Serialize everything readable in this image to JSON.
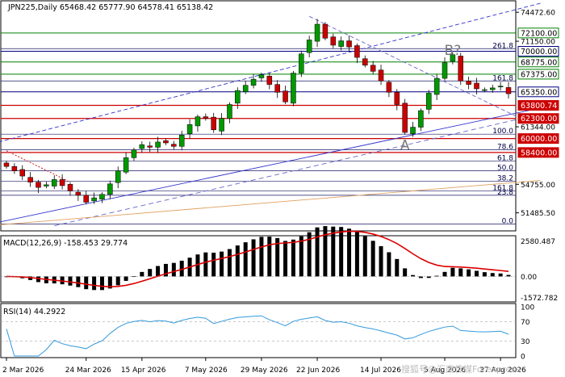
{
  "colors": {
    "background": "#ffffff",
    "panel_border": "#000000",
    "candle_up": "#009900",
    "candle_down": "#cc0000",
    "wick": "#000000",
    "green_level": "#008000",
    "red_level": "#cc0000",
    "navy_line": "#000080",
    "fib_line": "#1a1a66",
    "channel": "#3333cc",
    "trend": "#6666cc",
    "orange": "#e0a060",
    "macd_hist": "#000000",
    "macd_signal": "#dd0000",
    "rsi": "#3399dd",
    "level_box_green_bg": "#ffffff",
    "level_box_red_bg": "#cc0000"
  },
  "price_panel": {
    "header": "JPN225,Daily  65468.42 65777.90 64578.41 65138.42",
    "y_min": 49600,
    "y_max": 75600,
    "axis_ticks": [
      74472.6,
      71150.0,
      61344.0,
      54755.0,
      51485.5
    ],
    "level_boxes": [
      {
        "label": "72100.00",
        "value": 72100,
        "style": "green"
      },
      {
        "label": "70000.00",
        "value": 70000,
        "style": "navy"
      },
      {
        "label": "68775.00",
        "value": 68775,
        "style": "green"
      },
      {
        "label": "67375.00",
        "value": 67375,
        "style": "green"
      },
      {
        "label": "65350.00",
        "value": 65350,
        "style": "navy"
      },
      {
        "label": "63800.74",
        "value": 63800.74,
        "style": "red"
      },
      {
        "label": "62300.00",
        "value": 62300,
        "style": "red"
      },
      {
        "label": "60000.00",
        "value": 60000,
        "style": "red"
      },
      {
        "label": "58400.00",
        "value": 58400,
        "style": "red"
      }
    ],
    "fib_levels": [
      {
        "label": "261.8",
        "value": 70300
      },
      {
        "label": "161.8",
        "value": 66600
      },
      {
        "label": "100.0",
        "value": 60500
      },
      {
        "label": "78.6",
        "value": 58700
      },
      {
        "label": "61.8",
        "value": 57400
      },
      {
        "label": "50.0",
        "value": 56300
      },
      {
        "label": "38.2",
        "value": 55100
      },
      {
        "label": "161.8",
        "value": 54000
      },
      {
        "label": "23.8",
        "value": 53500
      },
      {
        "label": "0.0",
        "value": 50200
      }
    ],
    "annotations": [
      {
        "text": "A",
        "index": 50,
        "value": 58700
      },
      {
        "text": "B?",
        "index": 56,
        "value": 69600
      }
    ]
  },
  "macd_panel": {
    "header": "MACD(12,26,9) -158.453 29.774",
    "axis_ticks": [
      "2580.487",
      "0.00",
      "-1572.782"
    ],
    "max": 2580.487,
    "min": -1572.782
  },
  "rsi_panel": {
    "header": "RSI(14) 44.2922",
    "axis_ticks": [
      "100",
      "70",
      "30",
      "0"
    ]
  },
  "x_axis": {
    "labels": [
      {
        "text": "2 Mar 2026",
        "index": 0
      },
      {
        "text": "24 Mar 2026",
        "index": 10
      },
      {
        "text": "15 Apr 2026",
        "index": 17
      },
      {
        "text": "7 May 2026",
        "index": 25
      },
      {
        "text": "29 May 2026",
        "index": 32
      },
      {
        "text": "22 Jun 2026",
        "index": 39
      },
      {
        "text": "14 Jul 2026",
        "index": 47
      },
      {
        "text": "5 Aug 2026",
        "index": 55
      },
      {
        "text": "27 Aug 2026",
        "index": 62
      }
    ]
  },
  "watermark": "搜狐号@汇商传媒Forexpress",
  "chart_data": {
    "type": "candlestick",
    "title": "JPN225,Daily",
    "ohlc_current": {
      "open": 65468.42,
      "high": 65777.9,
      "low": 64578.41,
      "close": 65138.42
    },
    "close_series": [
      56800,
      56300,
      55700,
      55000,
      54400,
      54700,
      55300,
      54600,
      54000,
      53500,
      52700,
      53200,
      53600,
      54800,
      56300,
      57800,
      58700,
      59300,
      59000,
      59600,
      59500,
      59100,
      60400,
      61600,
      62500,
      62300,
      61000,
      62300,
      63900,
      65500,
      66100,
      66800,
      67300,
      66200,
      65300,
      64200,
      67500,
      69700,
      71300,
      73100,
      71500,
      70700,
      71200,
      70500,
      69300,
      68400,
      67700,
      66600,
      65300,
      63900,
      60700,
      61300,
      63200,
      65200,
      66900,
      68700,
      69600,
      66600,
      66200,
      65700,
      65600,
      65800,
      66000,
      65138
    ],
    "macd": {
      "current": -158.453,
      "signal_current": 29.774
    },
    "rsi": {
      "period": 14,
      "current": 44.2922,
      "levels": [
        70,
        30
      ]
    }
  }
}
